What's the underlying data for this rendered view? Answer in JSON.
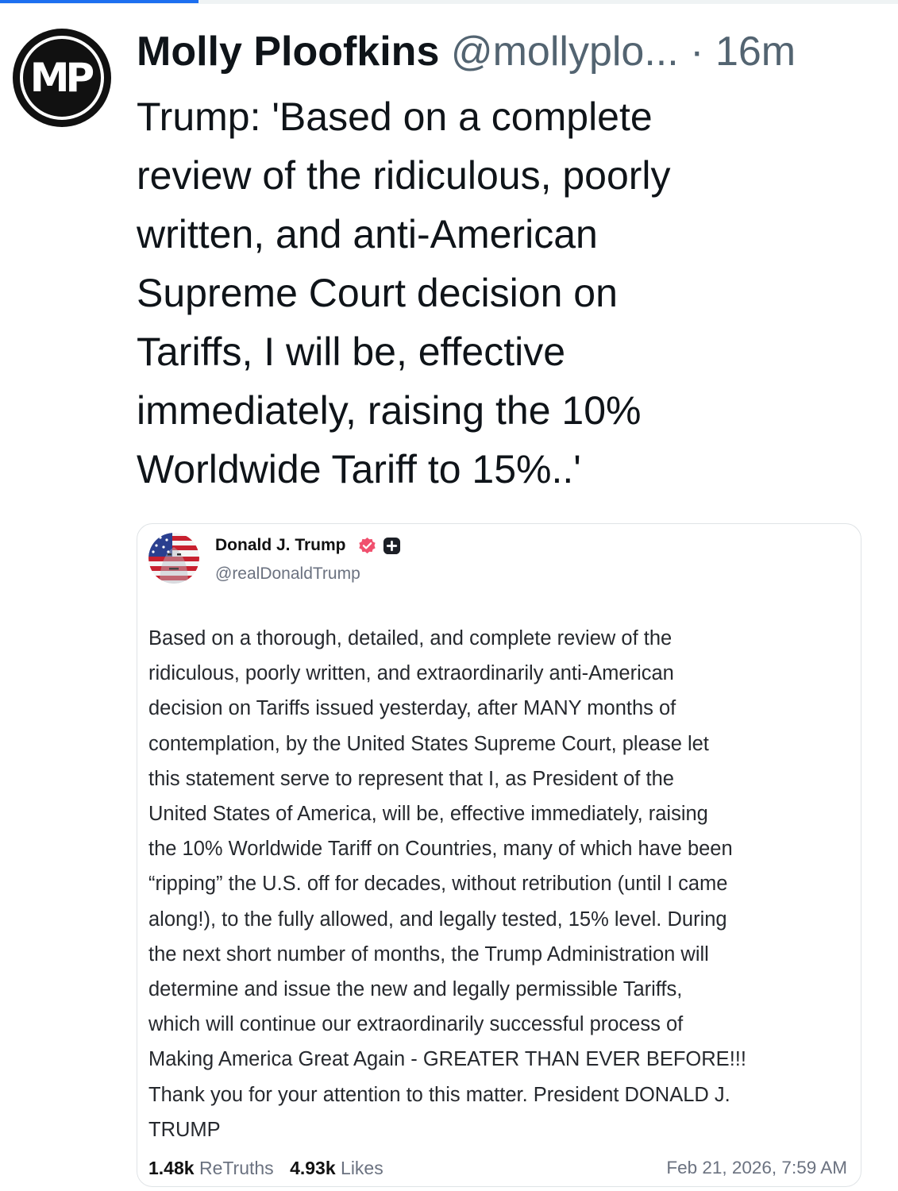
{
  "post": {
    "author_name": "Molly Ploofkins",
    "author_handle": "@mollyplo...",
    "separator": "·",
    "time": "16m",
    "avatar_initials": "MP",
    "text_lines": [
      "Trump: 'Based on a complete",
      "review of the ridiculous, poorly",
      "written, and anti-American",
      "Supreme Court decision on",
      "Tariffs, I will be, effective",
      "immediately, raising the 10%",
      "Worldwide Tariff to 15%..'"
    ]
  },
  "embed": {
    "author_name": "Donald J. Trump",
    "author_handle": "@realDonaldTrump",
    "text_lines": [
      "Based on a thorough, detailed, and complete review of the",
      "ridiculous, poorly written, and extraordinarily anti-American",
      "decision on Tariffs issued yesterday, after MANY months of",
      "contemplation, by the United States Supreme Court, please let",
      "this statement serve to represent that I, as President of the",
      "United States of America, will be, effective immediately, raising",
      "the 10% Worldwide Tariff on Countries, many of which have been",
      "“ripping” the U.S. off for decades, without retribution (until I came",
      "along!), to the fully allowed, and legally tested, 15% level. During",
      "the next short number of months, the Trump Administration will",
      "determine and issue the new and legally permissible Tariffs,",
      "which will continue our extraordinarily successful process of",
      "Making America Great Again - GREATER THAN EVER BEFORE!!!",
      "Thank you for your attention to this matter. President DONALD J.",
      "TRUMP"
    ],
    "retruths_count": "1.48k",
    "retruths_label": "ReTruths",
    "likes_count": "4.93k",
    "likes_label": "Likes",
    "date": "Feb 21, 2026, 7:59 AM"
  },
  "colors": {
    "accent": "#1d6ff0",
    "verified": "#f0506e",
    "secondary_text": "#536471"
  },
  "icons": {
    "verified_badge": "verified-badge-icon",
    "plus_badge": "plus-badge-icon"
  }
}
